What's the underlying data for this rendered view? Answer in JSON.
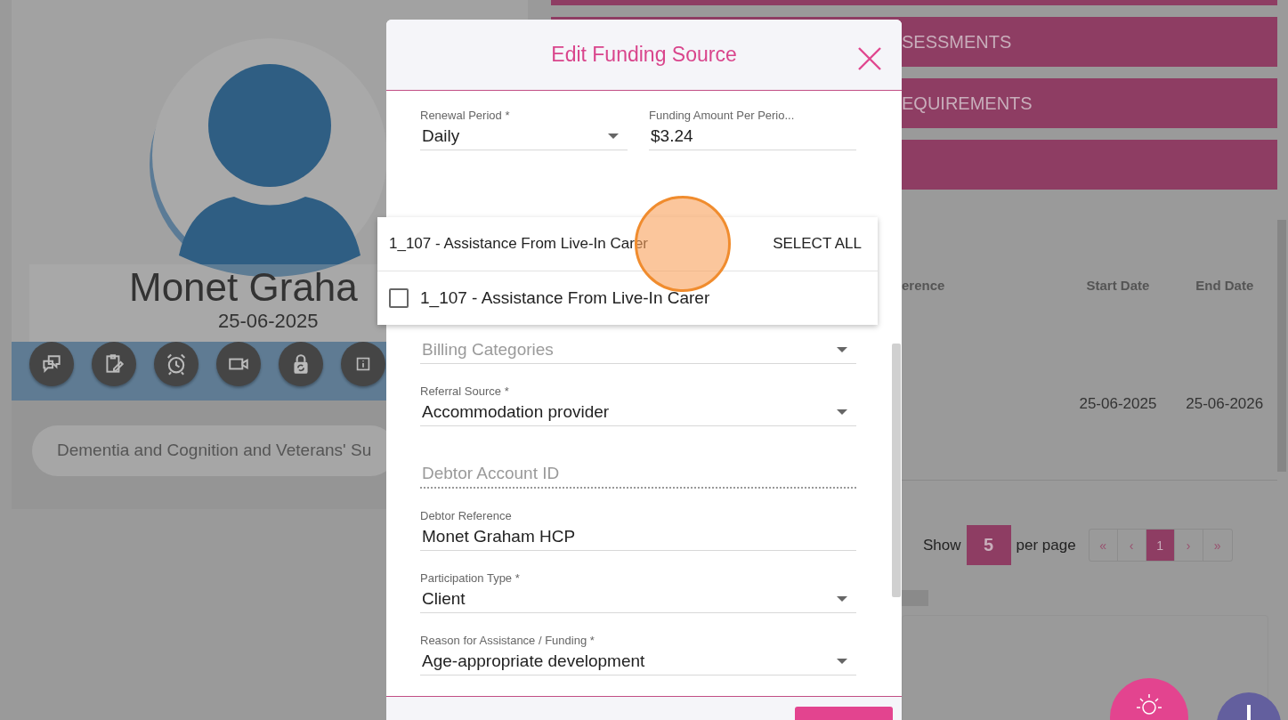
{
  "profile": {
    "name": "Monet Graha",
    "date": "25-06-2025",
    "actions": [
      {
        "kind": "chat"
      },
      {
        "kind": "notes"
      },
      {
        "kind": "alarm"
      },
      {
        "kind": "video"
      },
      {
        "kind": "lock"
      },
      {
        "kind": "info"
      }
    ],
    "tag": "Dementia and Cognition and Veterans' Su"
  },
  "sections": [
    {
      "kind": "bar"
    },
    {
      "kind": "labelled",
      "label": "SESSMENTS"
    },
    {
      "kind": "labelled",
      "label": "EQUIREMENTS"
    },
    {
      "kind": "bar"
    }
  ],
  "table": {
    "columns": [
      "erence",
      "Start Date",
      "End Date"
    ],
    "rows": [
      [
        "",
        "25-06-2025",
        "25-06-2026"
      ]
    ]
  },
  "pagination": {
    "show_label": "Show",
    "per_page": "5",
    "per_page_label": "per page",
    "pages": [
      {
        "label": "«",
        "selected": false
      },
      {
        "label": "‹",
        "selected": false
      },
      {
        "label": "1",
        "selected": true
      },
      {
        "label": "›",
        "selected": false
      },
      {
        "label": "»",
        "selected": false
      }
    ]
  },
  "fabs": [
    {
      "kind": "sun"
    },
    {
      "kind": "plus"
    }
  ],
  "modal": {
    "title": "Edit Funding Source",
    "rows": [
      [
        {
          "kind": "select",
          "label": "Renewal Period *",
          "value": "Daily",
          "disabled": false
        },
        {
          "kind": "input",
          "label": "Funding Amount Per Perio...",
          "value": "$3.24",
          "disabled": false
        }
      ],
      [
        {
          "kind": "gap"
        }
      ],
      [
        {
          "kind": "select",
          "placeholder": "Billing Categories",
          "disabled": false
        }
      ],
      [
        {
          "kind": "select",
          "label": "Referral Source *",
          "value": "Accommodation provider",
          "disabled": false
        }
      ],
      [
        {
          "kind": "input",
          "placeholder": "Debtor Account ID",
          "disabled": true
        }
      ],
      [
        {
          "kind": "input",
          "label": "Debtor Reference",
          "value": "Monet Graham HCP",
          "disabled": false
        }
      ],
      [
        {
          "kind": "select",
          "label": "Participation Type *",
          "value": "Client",
          "disabled": false
        }
      ],
      [
        {
          "kind": "select",
          "label": "Reason for Assistance / Funding *",
          "value": "Age-appropriate development",
          "disabled": false
        }
      ]
    ],
    "dropdown": {
      "header": "1_107 - Assistance From Live-In Carer",
      "select_all": "SELECT ALL",
      "options": [
        {
          "label": "1_107 - Assistance From Live-In Carer",
          "checked": false
        }
      ]
    }
  }
}
